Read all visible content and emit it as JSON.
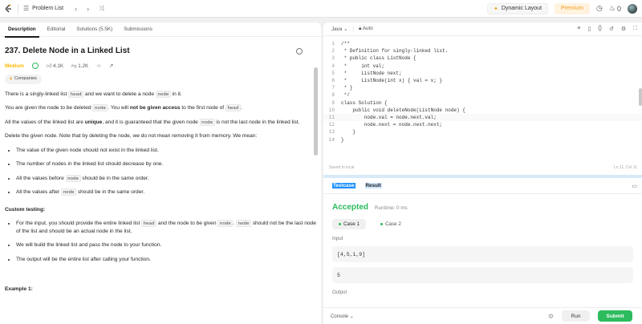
{
  "topbar": {
    "problem_list": "Problem List",
    "dynamic_layout": "Dynamic Layout",
    "premium": "Premium",
    "fire_count": "0"
  },
  "left_tabs": [
    "Description",
    "Editorial",
    "Solutions (5.5K)",
    "Submissions"
  ],
  "problem": {
    "title": "237. Delete Node in a Linked List",
    "difficulty": "Medium",
    "likes": "4.1K",
    "dislikes": "1.2K",
    "companies": "Companies"
  },
  "description": {
    "p1_a": "There is a singly-linked list ",
    "p1_code": "head",
    "p1_b": " and we want to delete a node ",
    "p1_code2": "node",
    "p1_c": " in it.",
    "p2_a": "You are given the node to be deleted ",
    "p2_code": "node",
    "p2_b": ". You will ",
    "p2_bold": "not be given access",
    "p2_c": " to the first node of ",
    "p2_code2": "head",
    "p2_d": ".",
    "p3_a": "All the values of the linked list are ",
    "p3_bold": "unique",
    "p3_b": ", and it is guaranteed that the given node ",
    "p3_code": "node",
    "p3_c": " is not the last node in the linked list.",
    "p4": "Delete the given node. Note that by deleting the node, we do not mean removing it from memory. We mean:",
    "bullets1": [
      {
        "a": "The value of the given node should not exist in the linked list.",
        "code": "",
        "b": ""
      },
      {
        "a": "The number of nodes in the linked list should decrease by one.",
        "code": "",
        "b": ""
      },
      {
        "a": "All the values before ",
        "code": "node",
        "b": " should be in the same order."
      },
      {
        "a": "All the values after ",
        "code": "node",
        "b": " should be in the same order."
      }
    ],
    "custom_testing": "Custom testing:",
    "ct1_a": "For the input, you should provide the entire linked list ",
    "ct1_code": "head",
    "ct1_b": " and the node to be given ",
    "ct1_code2": "node",
    "ct1_c": ". ",
    "ct1_code3": "node",
    "ct1_d": " should not be the last node of the list and should be an actual node in the list.",
    "ct2": "We will build the linked list and pass the node to your function.",
    "ct3": "The output will be the entire list after calling your function.",
    "example1": "Example 1:"
  },
  "editor": {
    "language": "Java",
    "auto": "Auto",
    "saved": "Saved to local",
    "position": "Ln 11, Col 11",
    "lines": [
      "/**",
      " * Definition for singly-linked list.",
      " * public class ListNode {",
      " *     int val;",
      " *     ListNode next;",
      " *     ListNode(int x) { val = x; }",
      " * }",
      " */",
      "class Solution {",
      "    public void deleteNode(ListNode node) {",
      "        node.val = node.next.val;",
      "        node.next = node.next.next;",
      "    }",
      "}"
    ]
  },
  "result": {
    "tab_testcase": "Testcase",
    "tab_result": "Result",
    "status": "Accepted",
    "runtime": "Runtime: 0 ms",
    "cases": [
      "Case 1",
      "Case 2"
    ],
    "input_label": "Input",
    "input1": "[4,5,1,9]",
    "input2": "5",
    "output_label": "Output",
    "console": "Console",
    "run": "Run",
    "submit": "Submit"
  }
}
